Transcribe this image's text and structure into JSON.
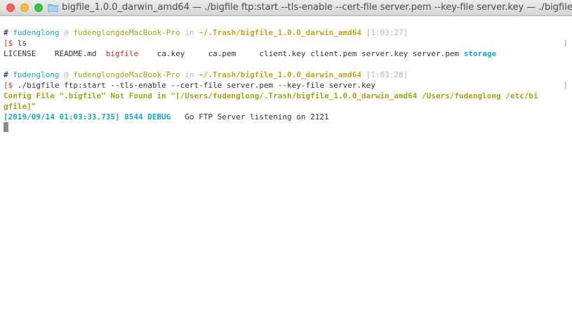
{
  "window": {
    "title": "bigfile_1.0.0_darwin_amd64 — ./bigfile ftp:start --tls-enable --cert-file server.pem --key-file server.key — ./bigfile — bigfile"
  },
  "prompt1": {
    "hash": "#",
    "user": "fudenglong",
    "at": "@",
    "host": "fudenglongdeMacBook-Pro",
    "in": "in",
    "path": "~/.Trash/bigfile_1.0.0_darwin_amd64",
    "time": "[1:03:27]",
    "dollar": "$",
    "command": "ls"
  },
  "ls_output": [
    {
      "name": "LICENSE",
      "kind": "file"
    },
    {
      "name": "README.md",
      "kind": "file"
    },
    {
      "name": "bigfile",
      "kind": "exec"
    },
    {
      "name": "ca.key",
      "kind": "file"
    },
    {
      "name": "ca.pem",
      "kind": "file"
    },
    {
      "name": "client.key",
      "kind": "file"
    },
    {
      "name": "client.pem",
      "kind": "file"
    },
    {
      "name": "server.key",
      "kind": "file"
    },
    {
      "name": "server.pem",
      "kind": "file"
    },
    {
      "name": "storage",
      "kind": "dir"
    }
  ],
  "prompt2": {
    "hash": "#",
    "user": "fudenglong",
    "at": "@",
    "host": "fudenglongdeMacBook-Pro",
    "in": "in",
    "path": "~/.Trash/bigfile_1.0.0_darwin_amd64",
    "time": "[1:03:28]",
    "dollar": "$",
    "command": "./bigfile ftp:start --tls-enable --cert-file server.pem --key-file server.key"
  },
  "output": {
    "config_line1": "Config File \".bigfile\" Not Found in \"[/Users/fudenglong/.Trash/bigfile_1.0.0_darwin_amd64 /Users/fudenglong /etc/bi",
    "config_line2": "gfile]\"",
    "log_timestamp": "[2019/09/14 01:03:33.735] 8544 DEBUG",
    "log_message": "Go FTP Server listening on 2121"
  }
}
